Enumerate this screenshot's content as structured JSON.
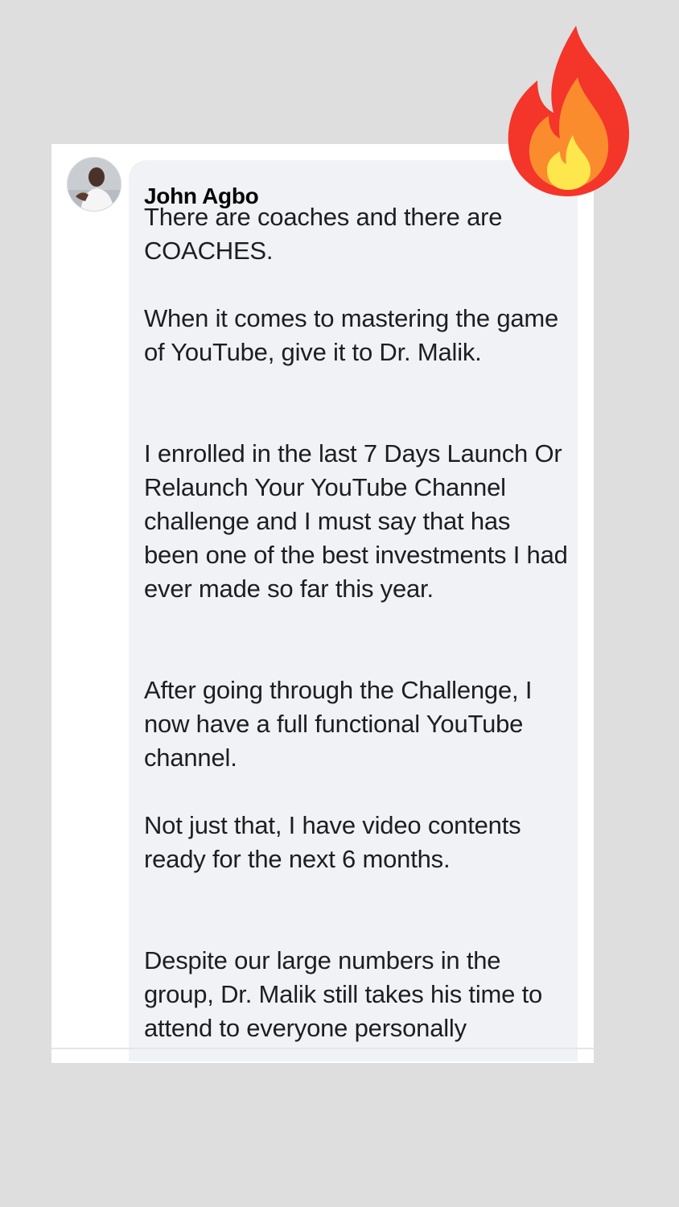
{
  "comment": {
    "author": "John Agbo",
    "paragraphs": [
      "There are coaches and there are COACHES.",
      "When it comes to mastering the game of YouTube, give it to Dr. Malik.",
      "I enrolled in the last 7 Days Launch Or Relaunch Your YouTube Channel challenge and I must say that has been one of the best investments I had ever made so far this year.",
      "After going through the Challenge, I now have a full functional YouTube channel.",
      "Not just that, I have video contents ready for the next 6 months.",
      "Despite our large numbers in the group, Dr. Malik still takes his time to attend to everyone personally"
    ]
  },
  "icons": {
    "avatar": "profile-photo",
    "sticker": "fire-icon"
  },
  "colors": {
    "background": "#dedede",
    "bubble": "#f0f2f5",
    "text": "#1c1e21",
    "fire_outer": "#f4352a",
    "fire_middle": "#fb8c2e",
    "fire_inner": "#fde74c"
  }
}
